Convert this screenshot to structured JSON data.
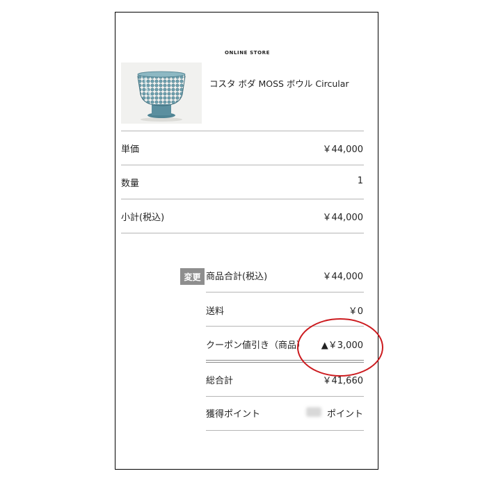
{
  "store": {
    "title": "ONLINE STORE"
  },
  "product": {
    "name": "コスタ ボダ MOSS ボウル Circular",
    "image_icon": "glass-bowl-icon"
  },
  "detail_rows": [
    {
      "label": "単価",
      "value": "￥44,000"
    },
    {
      "label": "数量",
      "value": "1"
    },
    {
      "label": "小計(税込)",
      "value": "￥44,000"
    }
  ],
  "summary": {
    "edit_label": "変更",
    "rows": [
      {
        "label": "商品合計(税込)",
        "value": "￥44,000"
      },
      {
        "label": "送料",
        "value": "￥0"
      },
      {
        "label": "クーポン値引き（商品）",
        "value": "▲￥3,000"
      },
      {
        "label": "総合計",
        "value": "￥41,660"
      },
      {
        "label": "獲得ポイント",
        "value": "ポイント"
      }
    ]
  },
  "colors": {
    "highlight_circle": "#cc1b1f",
    "edit_button_bg": "#8e8e8e",
    "divider": "#b5b5b5"
  }
}
